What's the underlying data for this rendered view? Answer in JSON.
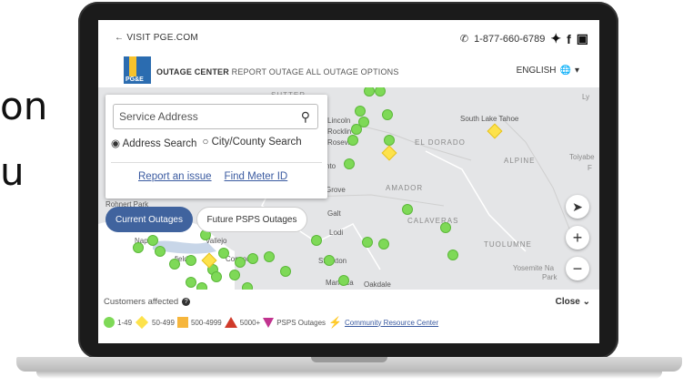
{
  "background_text": {
    "line1": "on",
    "line2": "u"
  },
  "topbar": {
    "back_label": "VISIT PGE.COM",
    "phone": "1-877-660-6789"
  },
  "nav": {
    "logo_text": "PG&E",
    "outage_center": "OUTAGE CENTER",
    "links": "REPORT OUTAGE ALL OUTAGE OPTIONS",
    "language": "ENGLISH"
  },
  "search": {
    "placeholder": "Service Address",
    "radio_address": "Address Search",
    "radio_city": "City/County Search",
    "report_issue": "Report an issue",
    "find_meter": "Find Meter ID"
  },
  "tabs": {
    "current": "Current Outages",
    "future": "Future PSPS Outages"
  },
  "map_labels": {
    "sutter": "SUTTER",
    "lincoln": "Lincoln",
    "rocklin": "Rocklin",
    "roseville": "Roseville",
    "south_lake_tahoe": "South Lake Tahoe",
    "el_dorado": "EL DORADO",
    "alpine": "ALPINE",
    "toiyabe": "Toiyabe",
    "toiyabe_f": "F",
    "sacramento": "nto",
    "elk_grove": "Grove",
    "amador": "AMADOR",
    "galt": "Galt",
    "calaveras": "CALAVERAS",
    "lodi": "Lodi",
    "vallejo": "Vallejo",
    "concord": "Concord",
    "fairfield": "field",
    "stockton": "Stockton",
    "tuolumne": "TUOLUMNE",
    "yosemite": "Yosemite Na",
    "park": "Park",
    "manteca": "Manteca",
    "oakdale": "Oakdale",
    "napa": "Napa",
    "rohnert_park": "Rohnert Park",
    "lyon": "Ly"
  },
  "legend": {
    "title": "Customers affected",
    "close": "Close",
    "range1": "1-49",
    "range2": "50-499",
    "range3": "500-4999",
    "range4": "5000+",
    "psps": "PSPS Outages",
    "crc": "Community Resource Center"
  },
  "colors": {
    "green": "#7ed957",
    "yellow": "#fde24b",
    "orange": "#f6b63c",
    "red": "#d03a2a",
    "psps": "#c1338f",
    "tab_active": "#40639e",
    "link": "#3a5aa0"
  }
}
